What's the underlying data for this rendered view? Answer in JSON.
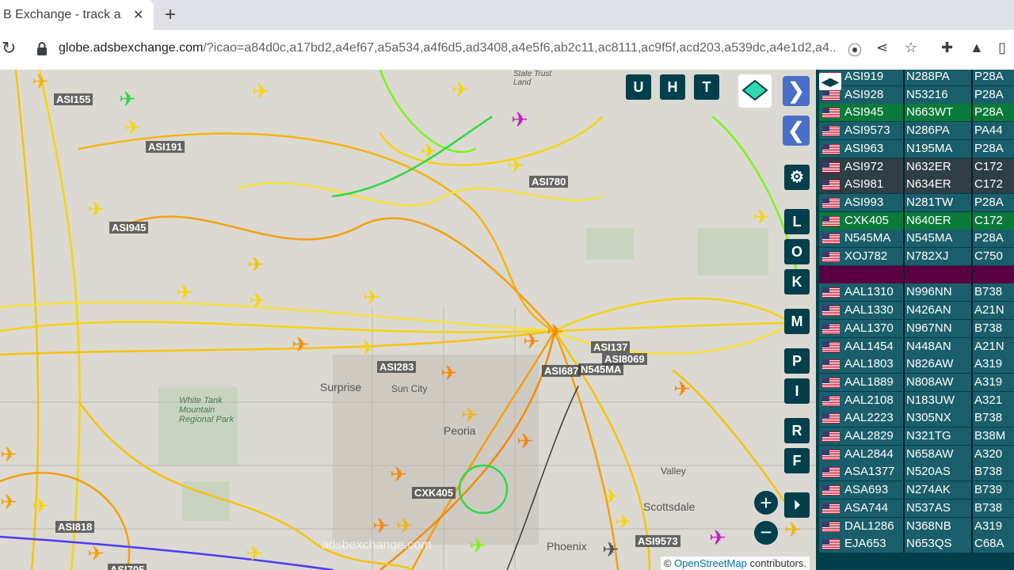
{
  "browser": {
    "tab_title": "B Exchange - track a",
    "new_tab": "+",
    "url_host": "globe.adsbexchange.com",
    "url_path": "/?icao=a84d0c,a17bd2,a4ef67,a5a534,a4f6d5,ad3408,a4e5f6,ab2c11,ac8111,ac9f5f,acd203,a539dc,a4e1d2,a4..."
  },
  "map": {
    "buttons_top": [
      "U",
      "H",
      "T"
    ],
    "buttons_side": [
      "L",
      "O",
      "K",
      "M",
      "P",
      "I",
      "R",
      "F"
    ],
    "callsigns": [
      "ASI155",
      "ASI191",
      "ASI945",
      "ASI780",
      "ASI283",
      "ASI137",
      "ASI8069",
      "ASI687",
      "N545MA",
      "CXK405",
      "ASI818",
      "ASI9573",
      "ASI705"
    ],
    "places": [
      "Surprise",
      "Sun City",
      "White Tank Mountain Regional Park",
      "Peoria",
      "Scottsdale",
      "Phoenix",
      "Valley",
      "State Trust Land"
    ],
    "watermark": "adsbexchange.com",
    "attribution_prefix": "©",
    "attribution_link": "OpenStreetMap",
    "attribution_suffix": "contributors."
  },
  "colors": {
    "accent": "#003f4b",
    "track_yellow": "#f5d40f",
    "track_orange": "#f5a00f",
    "track_green": "#7cf51a"
  },
  "table": {
    "rows": [
      {
        "callsign": "ASI919",
        "reg": "N288PA",
        "type": "P28A",
        "highlight": ""
      },
      {
        "callsign": "ASI928",
        "reg": "N53216",
        "type": "P28A",
        "highlight": ""
      },
      {
        "callsign": "ASI945",
        "reg": "N663WT",
        "type": "P28A",
        "highlight": "green"
      },
      {
        "callsign": "ASI9573",
        "reg": "N286PA",
        "type": "PA44",
        "highlight": ""
      },
      {
        "callsign": "ASI963",
        "reg": "N195MA",
        "type": "P28A",
        "highlight": ""
      },
      {
        "callsign": "ASI972",
        "reg": "N632ER",
        "type": "C172",
        "highlight": "dark"
      },
      {
        "callsign": "ASI981",
        "reg": "N634ER",
        "type": "C172",
        "highlight": "dark"
      },
      {
        "callsign": "ASI993",
        "reg": "N281TW",
        "type": "P28A",
        "highlight": ""
      },
      {
        "callsign": "CXK405",
        "reg": "N640ER",
        "type": "C172",
        "highlight": "green"
      },
      {
        "callsign": "N545MA",
        "reg": "N545MA",
        "type": "P28A",
        "highlight": ""
      },
      {
        "callsign": "XOJ782",
        "reg": "N782XJ",
        "type": "C750",
        "highlight": ""
      },
      {
        "callsign": "",
        "reg": "",
        "type": "",
        "highlight": "purple"
      },
      {
        "callsign": "AAL1310",
        "reg": "N996NN",
        "type": "B738",
        "highlight": ""
      },
      {
        "callsign": "AAL1330",
        "reg": "N426AN",
        "type": "A21N",
        "highlight": ""
      },
      {
        "callsign": "AAL1370",
        "reg": "N967NN",
        "type": "B738",
        "highlight": ""
      },
      {
        "callsign": "AAL1454",
        "reg": "N448AN",
        "type": "A21N",
        "highlight": ""
      },
      {
        "callsign": "AAL1803",
        "reg": "N826AW",
        "type": "A319",
        "highlight": ""
      },
      {
        "callsign": "AAL1889",
        "reg": "N808AW",
        "type": "A319",
        "highlight": ""
      },
      {
        "callsign": "AAL2108",
        "reg": "N183UW",
        "type": "A321",
        "highlight": ""
      },
      {
        "callsign": "AAL2223",
        "reg": "N305NX",
        "type": "B738",
        "highlight": ""
      },
      {
        "callsign": "AAL2829",
        "reg": "N321TG",
        "type": "B38M",
        "highlight": ""
      },
      {
        "callsign": "AAL2844",
        "reg": "N658AW",
        "type": "A320",
        "highlight": ""
      },
      {
        "callsign": "ASA1377",
        "reg": "N520AS",
        "type": "B738",
        "highlight": ""
      },
      {
        "callsign": "ASA693",
        "reg": "N274AK",
        "type": "B739",
        "highlight": ""
      },
      {
        "callsign": "ASA744",
        "reg": "N537AS",
        "type": "B738",
        "highlight": ""
      },
      {
        "callsign": "DAL1286",
        "reg": "N368NB",
        "type": "A319",
        "highlight": ""
      },
      {
        "callsign": "EJA653",
        "reg": "N653QS",
        "type": "C68A",
        "highlight": ""
      }
    ]
  }
}
